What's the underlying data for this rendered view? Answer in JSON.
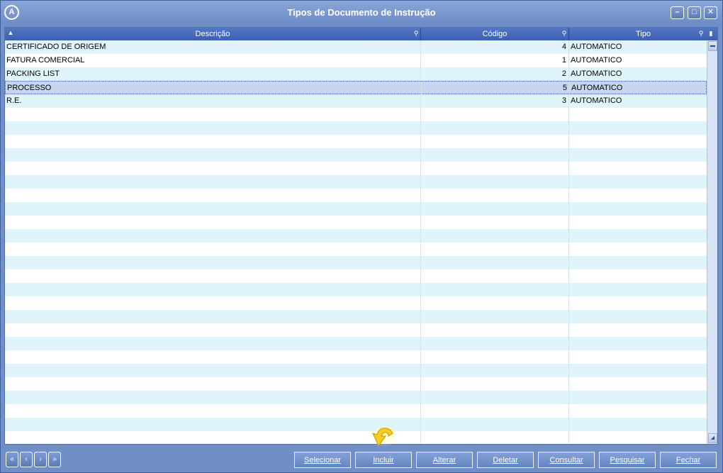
{
  "window": {
    "title": "Tipos de Documento de Instrução"
  },
  "titlebar_buttons": {
    "minimize": "–",
    "maximize": "□",
    "close": "✕"
  },
  "grid": {
    "columns": [
      {
        "label": "Descrição"
      },
      {
        "label": "Código"
      },
      {
        "label": "Tipo"
      }
    ],
    "rows": [
      {
        "descricao": "CERTIFICADO DE ORIGEM",
        "codigo": "4",
        "tipo": "AUTOMATICO"
      },
      {
        "descricao": "FATURA COMERCIAL",
        "codigo": "1",
        "tipo": "AUTOMATICO"
      },
      {
        "descricao": "PACKING LIST",
        "codigo": "2",
        "tipo": "AUTOMATICO"
      },
      {
        "descricao": "PROCESSO",
        "codigo": "5",
        "tipo": "AUTOMATICO",
        "selected": true
      },
      {
        "descricao": "R.E.",
        "codigo": "3",
        "tipo": "AUTOMATICO"
      }
    ]
  },
  "navigation": {
    "first": "«",
    "prev": "‹",
    "next": "›",
    "last": "»"
  },
  "actions": {
    "selecionar": "Selecionar",
    "incluir": "Incluir",
    "alterar": "Alterar",
    "deletar": "Deletar",
    "consultar": "Consultar",
    "pesquisar": "Pesquisar",
    "fechar": "Fechar"
  },
  "colors": {
    "title_bg": "#7a97c9",
    "header_bg": "#4a6fc0",
    "row_alt": "#e0f4fb",
    "selected_row": "#c7d5ee"
  }
}
